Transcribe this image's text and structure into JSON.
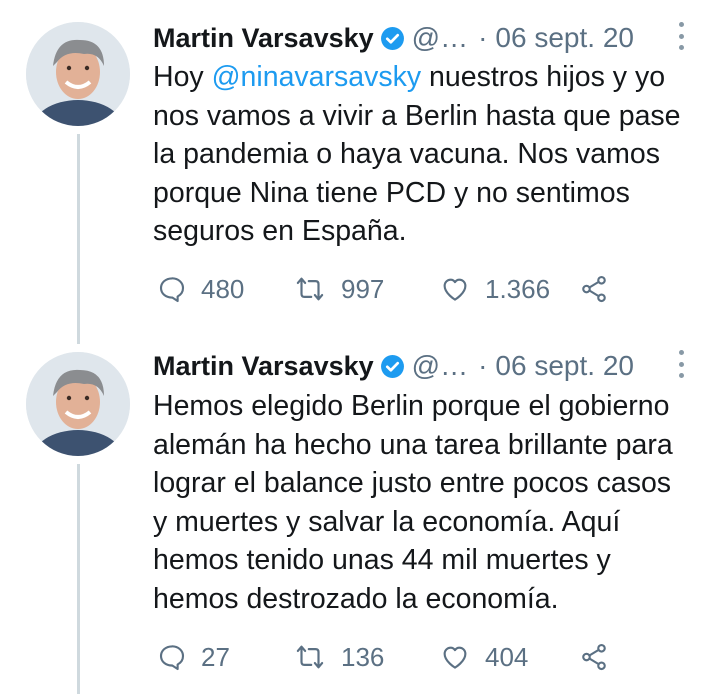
{
  "tweets": [
    {
      "author_name": "Martin Varsavsky",
      "handle": "@…",
      "separator": "·",
      "date": "06 sept. 20",
      "text_lines": [
        {
          "pre": "Hoy ",
          "mention": "@ninavarsavsky",
          "post": " nuestros hijos y yo"
        },
        {
          "pre": "nos vamos a vivir a Berlin hasta que pase"
        },
        {
          "pre": "la pandemia o haya vacuna. Nos vamos"
        },
        {
          "pre": "porque Nina tiene PCD y no sentimos"
        },
        {
          "pre": "seguros en España."
        }
      ],
      "replies": "480",
      "retweets": "997",
      "likes": "1.366"
    },
    {
      "author_name": "Martin Varsavsky",
      "handle": "@…",
      "separator": "·",
      "date": "06 sept. 20",
      "text_lines": [
        {
          "pre": "Hemos elegido Berlin porque el gobierno"
        },
        {
          "pre": "alemán ha hecho una tarea brillante para"
        },
        {
          "pre": "lograr el balance justo entre pocos casos"
        },
        {
          "pre": "y muertes y salvar la economía. Aquí"
        },
        {
          "pre": "hemos tenido unas 44 mil muertes y"
        },
        {
          "pre": "hemos destrozado la economía."
        }
      ],
      "replies": "27",
      "retweets": "136",
      "likes": "404"
    }
  ],
  "colors": {
    "verified": "#1d9bf0",
    "mention": "#1d9bf0",
    "muted": "#5b7083",
    "thread_line": "#cfd9de"
  },
  "icons": {
    "verified": "verified-badge-icon",
    "more": "more-vertical-icon",
    "reply": "reply-icon",
    "retweet": "retweet-icon",
    "like": "heart-icon",
    "share": "share-icon"
  }
}
